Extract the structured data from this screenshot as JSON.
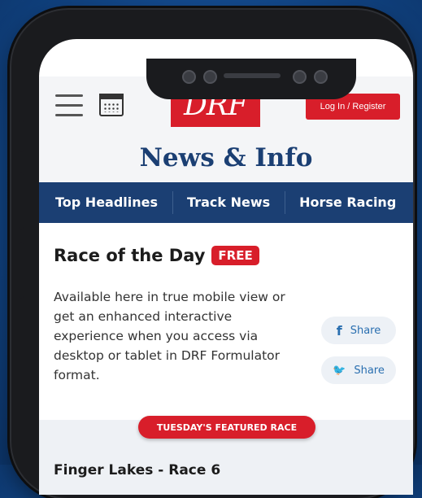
{
  "header": {
    "logo_text": "DRF",
    "login_label": "Log In / Register"
  },
  "title": "News & Info",
  "nav": {
    "tabs": [
      "Top Headlines",
      "Track News",
      "Horse Racing"
    ]
  },
  "race_of_day": {
    "heading": "Race of the Day",
    "badge": "FREE",
    "description": "Available here in true mobile view or get an enhanced interactive experience when you access via desktop or tablet in DRF Formulator format.",
    "share_facebook_icon": "f",
    "share_twitter_icon": "🐦",
    "share_label": "Share"
  },
  "featured": {
    "label": "TUESDAY'S FEATURED RACE",
    "race_name": "Finger Lakes - Race 6"
  },
  "colors": {
    "accent_red": "#d81e2a",
    "navy": "#1b3f73",
    "background_blue": "#134a8e"
  }
}
